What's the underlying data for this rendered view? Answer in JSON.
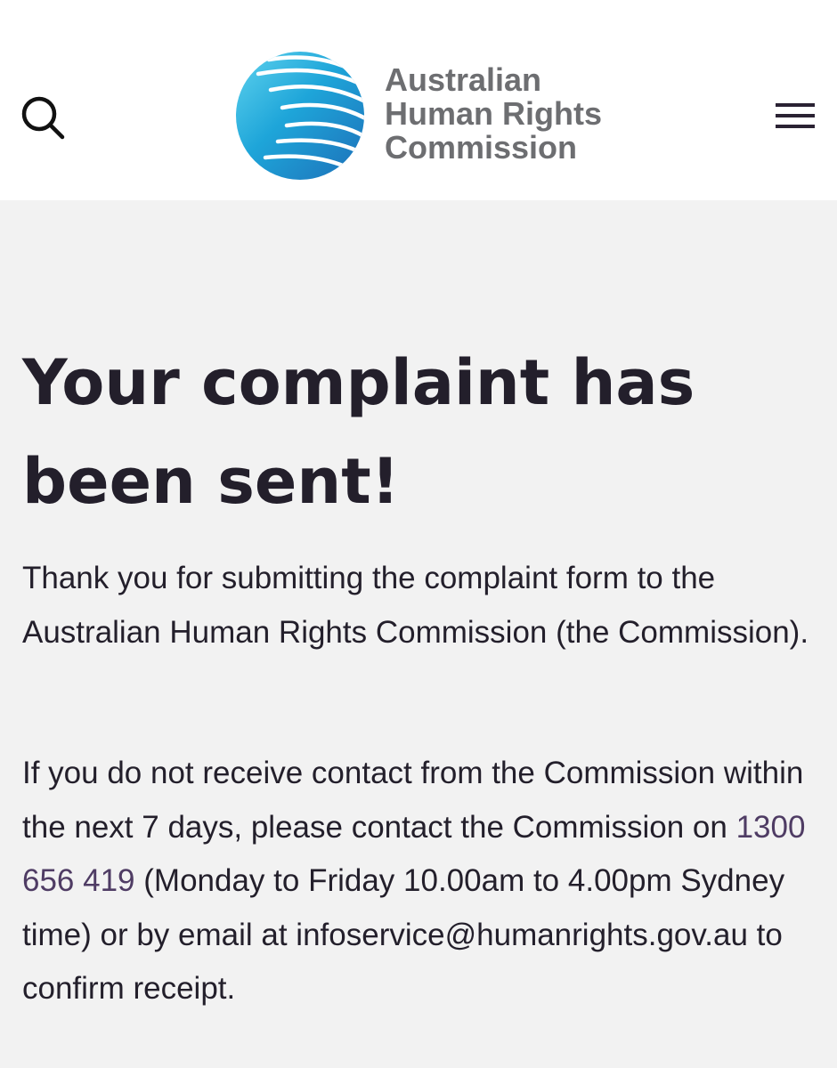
{
  "header": {
    "logo": {
      "line1": "Australian",
      "line2": "Human Rights",
      "line3": "Commission"
    },
    "search_icon": "search-icon",
    "menu_icon": "hamburger-menu-icon"
  },
  "main": {
    "title": "Your complaint has been sent!",
    "paragraph1": "Thank you for submitting the complaint form to the Australian Human Rights Commission (the Commission).",
    "paragraph2": {
      "before_phone": "If you do not receive contact from the Commission within the next 7 days, please contact the Commission on ",
      "phone": "1300 656 419",
      "after_phone": " (Monday to Friday 10.00am to 4.00pm Sydney time) or by email at infoservice@humanrights.gov.au to confirm receipt."
    }
  },
  "colors": {
    "header_bg": "#ffffff",
    "page_bg": "#f2f2f2",
    "text": "#231f2b",
    "link": "#4f3c64",
    "logo_text": "#6d6e71",
    "logo_blue_light": "#3ec6e8",
    "logo_blue_dark": "#1d6fb8"
  }
}
